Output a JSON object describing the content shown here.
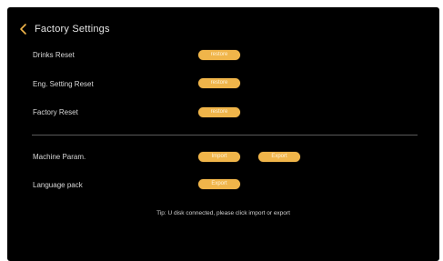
{
  "header": {
    "title": "Factory Settings",
    "back_icon": "chevron-left-icon"
  },
  "colors": {
    "background": "#000000",
    "accent": "#f0b54a",
    "text": "#d8d8d8",
    "divider": "#5a5a5a"
  },
  "rows": {
    "drinks_reset": {
      "label": "Drinks Reset",
      "button": "restore"
    },
    "eng_setting_reset": {
      "label": "Eng. Setting Reset",
      "button": "restore"
    },
    "factory_reset": {
      "label": "Factory Reset",
      "button": "restore"
    },
    "machine_param": {
      "label": "Machine Param.",
      "import_button": "Import",
      "export_button": "Export"
    },
    "language_pack": {
      "label": "Language pack",
      "button": "Export"
    }
  },
  "tip": "Tip:  U disk connected, please click import or export"
}
